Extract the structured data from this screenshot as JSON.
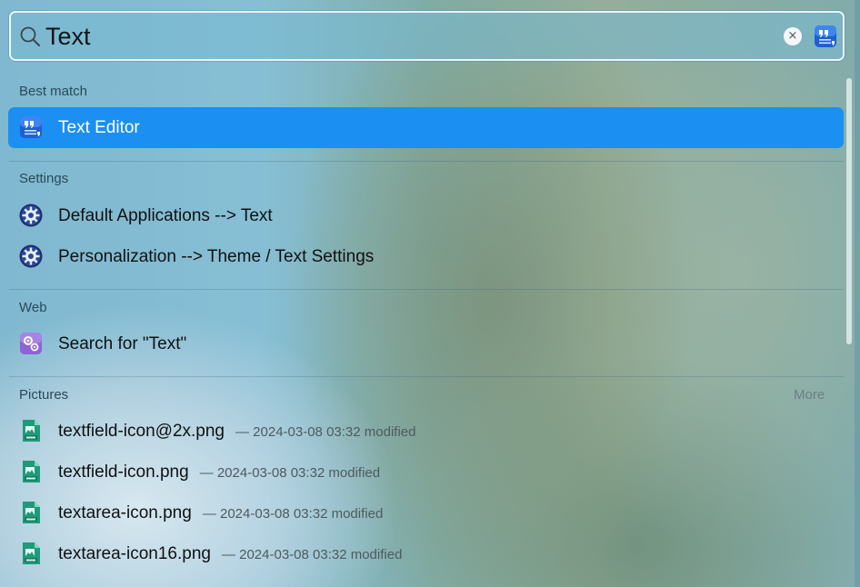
{
  "search": {
    "value": "Text",
    "clear_symbol": "×"
  },
  "sections": {
    "best_match": {
      "title": "Best match",
      "items": [
        {
          "label": "Text Editor",
          "icon": "text-editor-icon"
        }
      ]
    },
    "settings": {
      "title": "Settings",
      "items": [
        {
          "label": "Default Applications --> Text",
          "icon": "gear-icon"
        },
        {
          "label": "Personalization --> Theme / Text Settings",
          "icon": "gear-icon"
        }
      ]
    },
    "web": {
      "title": "Web",
      "items": [
        {
          "label": "Search for \"Text\"",
          "icon": "web-search-icon"
        }
      ]
    },
    "pictures": {
      "title": "Pictures",
      "more_label": "More",
      "items": [
        {
          "label": "textfield-icon@2x.png",
          "meta": "— 2024-03-08 03:32 modified",
          "icon": "png-file-icon"
        },
        {
          "label": "textfield-icon.png",
          "meta": "— 2024-03-08 03:32 modified",
          "icon": "png-file-icon"
        },
        {
          "label": "textarea-icon.png",
          "meta": "— 2024-03-08 03:32 modified",
          "icon": "png-file-icon"
        },
        {
          "label": "textarea-icon16.png",
          "meta": "— 2024-03-08 03:32 modified",
          "icon": "png-file-icon"
        }
      ]
    }
  },
  "colors": {
    "selection": "#1b8ff2",
    "section_title": "#2a4a5a"
  }
}
